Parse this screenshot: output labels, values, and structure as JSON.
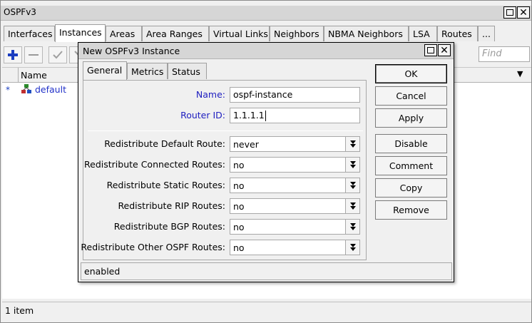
{
  "main_window": {
    "title": "OSPFv3",
    "tabs": [
      {
        "label": "Interfaces",
        "active": false
      },
      {
        "label": "Instances",
        "active": true
      },
      {
        "label": "Areas",
        "active": false
      },
      {
        "label": "Area Ranges",
        "active": false
      },
      {
        "label": "Virtual Links",
        "active": false
      },
      {
        "label": "Neighbors",
        "active": false
      },
      {
        "label": "NBMA Neighbors",
        "active": false
      },
      {
        "label": "LSA",
        "active": false
      },
      {
        "label": "Routes",
        "active": false
      },
      {
        "label": "...",
        "active": false
      }
    ],
    "toolbar": {
      "add_icon": "plus-icon",
      "remove_icon": "minus-icon",
      "enable_icon": "checkmark-icon",
      "find_placeholder": "Find"
    },
    "table": {
      "columns": [
        "Name"
      ],
      "rows": [
        {
          "marker": "*",
          "icon": "ospf-instance-icon",
          "name": "default"
        }
      ]
    },
    "status": "1 item"
  },
  "dialog": {
    "title": "New OSPFv3 Instance",
    "tabs": [
      {
        "label": "General",
        "active": true
      },
      {
        "label": "Metrics",
        "active": false
      },
      {
        "label": "Status",
        "active": false
      }
    ],
    "fields": {
      "name": {
        "label": "Name:",
        "value": "ospf-instance"
      },
      "router_id": {
        "label": "Router ID:",
        "value": "1.1.1.1"
      }
    },
    "redistribute": [
      {
        "label": "Redistribute Default Route:",
        "value": "never"
      },
      {
        "label": "Redistribute Connected Routes:",
        "value": "no"
      },
      {
        "label": "Redistribute Static Routes:",
        "value": "no"
      },
      {
        "label": "Redistribute RIP Routes:",
        "value": "no"
      },
      {
        "label": "Redistribute BGP Routes:",
        "value": "no"
      },
      {
        "label": "Redistribute Other OSPF Routes:",
        "value": "no"
      }
    ],
    "buttons": {
      "ok": "OK",
      "cancel": "Cancel",
      "apply": "Apply",
      "disable": "Disable",
      "comment": "Comment",
      "copy": "Copy",
      "remove": "Remove"
    },
    "status": "enabled"
  },
  "colors": {
    "label_blue": "#2020c0",
    "add_blue": "#1a3dc0",
    "link_blue": "#2030c8"
  }
}
